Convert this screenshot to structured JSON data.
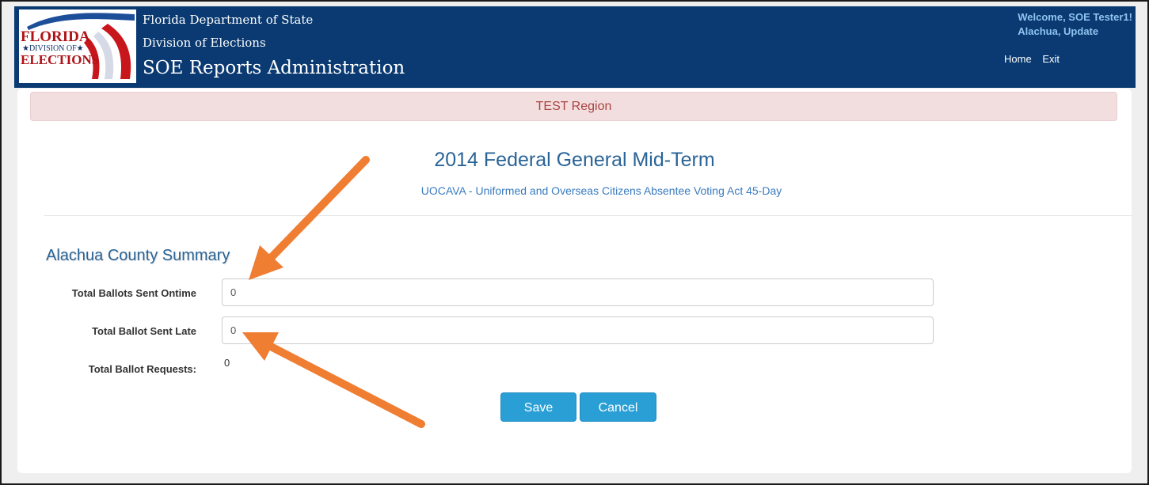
{
  "header": {
    "logo": {
      "line1": "FLORIDA",
      "line2": "★DIVISION OF★",
      "line3": "ELECTIONS"
    },
    "department": "Florida Department of State",
    "division": "Division of Elections",
    "app_title": "SOE Reports Administration",
    "welcome": "Welcome, SOE Tester1!",
    "context": "Alachua, Update",
    "nav": {
      "home": "Home",
      "exit": "Exit"
    }
  },
  "banner": {
    "text": "TEST Region"
  },
  "election": {
    "title": "2014 Federal General Mid-Term",
    "subtitle": "UOCAVA - Uniformed and Overseas Citizens Absentee Voting Act 45-Day"
  },
  "summary": {
    "heading": "Alachua County Summary",
    "fields": [
      {
        "label": "Total Ballots Sent Ontime",
        "value": "0"
      },
      {
        "label": "Total Ballot Sent Late",
        "value": "0"
      },
      {
        "label": "Total Ballot Requests:",
        "value": "0"
      }
    ]
  },
  "actions": {
    "save": "Save",
    "cancel": "Cancel"
  },
  "colors": {
    "header_bg": "#0a3a71",
    "banner_bg": "#f2dede",
    "banner_text": "#a94442",
    "button": "#2a9fd6",
    "annotation_arrow": "#ef7d32"
  }
}
